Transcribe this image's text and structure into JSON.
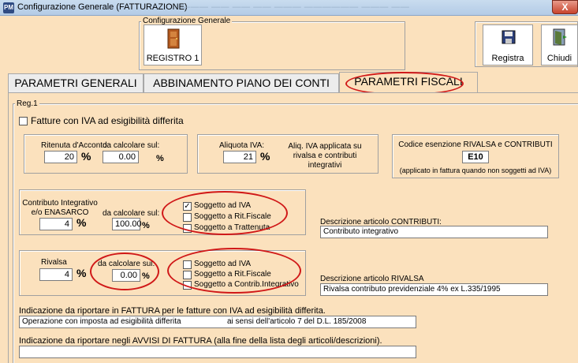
{
  "window": {
    "icon_text": "PM",
    "title": "Configurazione Generale (FATTURAZIONE)",
    "blurred_text": "——— ——  ——  ——  ———  ——————  ——— ——",
    "close_label": "X"
  },
  "toolbar": {
    "group_label": "Configurazione Generale",
    "registro_label": "REGISTRO 1",
    "registra_label": "Registra",
    "chiudi_label": "Chiudi"
  },
  "tabs": [
    {
      "label": "PARAMETRI GENERALI"
    },
    {
      "label": "ABBINAMENTO PIANO DEI CONTI"
    },
    {
      "label": "PARAMETRI FISCALI"
    }
  ],
  "panel": {
    "group_label": "Reg.1",
    "iva_differita_label": "Fatture con IVA ad esigibilità differita",
    "ritenuta": {
      "label": "Ritenuta d'Acconto:",
      "calc_label": "da calcolare sul:",
      "value": "20",
      "base": "0.00",
      "pct": "%"
    },
    "aliquota": {
      "label": "Aliquota IVA:",
      "value": "21",
      "pct": "%",
      "note": "Aliq. IVA applicata su rivalsa e contributi integrativi"
    },
    "codice": {
      "label": "Codice esenzione RIVALSA e CONTRIBUTI",
      "value": "E10",
      "note": "(applicato in fattura quando non soggetti ad IVA)"
    },
    "contributo": {
      "label": "Contributo Integrativo e/o ENASARCO",
      "calc_label": "da calcolare sul:",
      "value": "4",
      "base": "100.00",
      "pct": "%",
      "options": [
        {
          "label": "Soggetto ad IVA",
          "checked": "✓"
        },
        {
          "label": "Soggetto a Rit.Fiscale",
          "checked": ""
        },
        {
          "label": "Soggetto a Trattenuta",
          "checked": ""
        }
      ],
      "desc_label": "Descrizione articolo CONTRIBUTI:",
      "desc_value": "Contributo integrativo"
    },
    "rivalsa": {
      "label": "Rivalsa",
      "calc_label": "da calcolare sul:",
      "value": "4",
      "base": "0.00",
      "pct": "%",
      "options": [
        {
          "label": "Soggetto ad IVA",
          "checked": ""
        },
        {
          "label": "Soggetto a Rit.Fiscale",
          "checked": ""
        },
        {
          "label": "Soggetto a Contrib.Integrativo",
          "checked": ""
        }
      ],
      "desc_label": "Descrizione articolo RIVALSA",
      "desc_value": "Rivalsa contributo previdenziale 4% ex L.335/1995"
    },
    "indicazione_fattura_label": "Indicazione da riportare in FATTURA per le fatture con IVA ad esigibilità differita.",
    "indicazione_fattura_value": "Operazione con imposta ad esigibilità differita                     ai sensi dell'articolo 7 del D.L. 185/2008",
    "indicazione_avvisi_label": "Indicazione da riportare negli AVVISI DI FATTURA (alla fine della lista degli articoli/descrizioni).",
    "indicazione_avvisi_value": ""
  }
}
